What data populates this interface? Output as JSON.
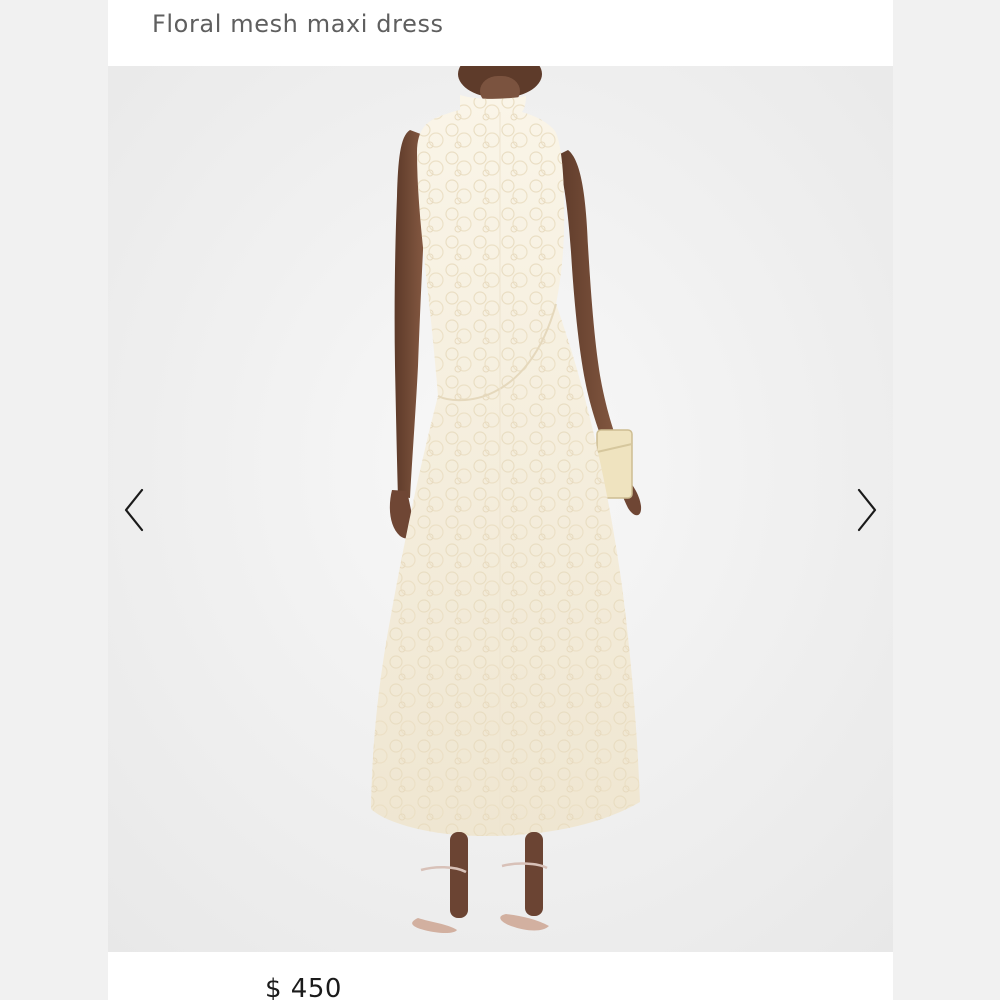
{
  "product": {
    "title": "Floral mesh maxi dress",
    "price": "$ 450"
  },
  "gallery": {
    "prev_icon": "chevron-left-icon",
    "next_icon": "chevron-right-icon",
    "image_description_name": "product-photo"
  },
  "colors": {
    "page_bg": "#f2f2f2",
    "card_bg": "#ffffff",
    "title_text": "#5f5f5f",
    "price_text": "#1b1b1b",
    "photo_bg": "#efefef",
    "dress": "#f5efdf",
    "skin": "#7a513b",
    "clutch": "#efe3bf"
  }
}
